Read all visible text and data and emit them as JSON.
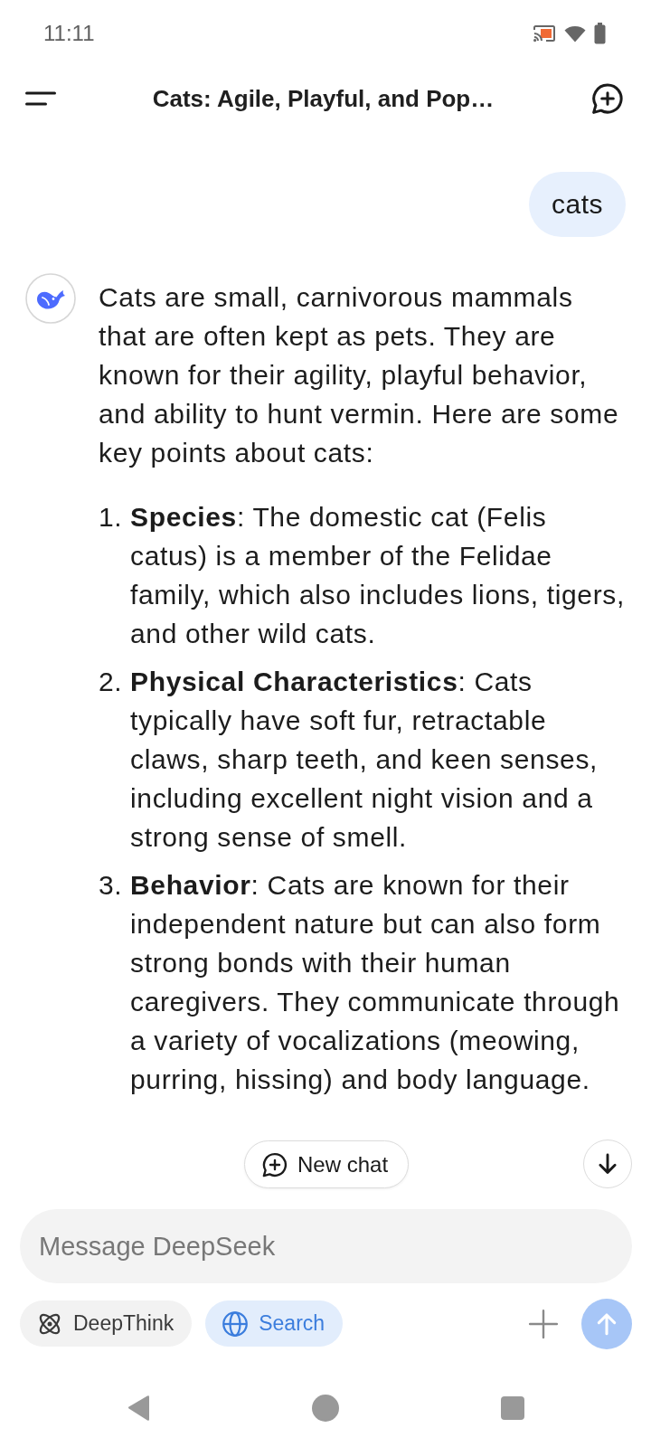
{
  "status_bar": {
    "time": "11:11"
  },
  "header": {
    "title": "Cats: Agile, Playful, and Pop…"
  },
  "messages": [
    {
      "kind": "user",
      "text": "cats"
    },
    {
      "kind": "assistant",
      "text": "Cats are small, carnivorous mammals that are often kept as pets. They are known for their agility, playful behavior, and ability to hunt vermin. Here are some key points about cats:",
      "points": [
        {
          "number": "1.",
          "text": "**Species**: The domestic cat (Felis catus) is a member of the Felidae family, which also includes lions, tigers, and other wild cats."
        },
        {
          "number": "2.",
          "text": "**Physical Characteristics**: Cats typically have soft fur, retractable claws, sharp teeth, and keen senses, including excellent night vision and a strong sense of smell."
        },
        {
          "number": "3.",
          "text": "**Behavior**: Cats are known for their independent nature but can also form strong bonds with their human caregivers. They communicate through a variety of vocalizations (meowing, purring, hissing) and body language."
        }
      ]
    }
  ],
  "new_chat_button": {
    "label": "New chat"
  },
  "composer": {
    "placeholder": "Message DeepSeek",
    "toggles": [
      {
        "kind": "deepthink",
        "label": "DeepThink",
        "selected": false
      },
      {
        "kind": "search",
        "label": "Search",
        "selected": true
      }
    ],
    "send_button": {
      "disabled": true
    }
  }
}
